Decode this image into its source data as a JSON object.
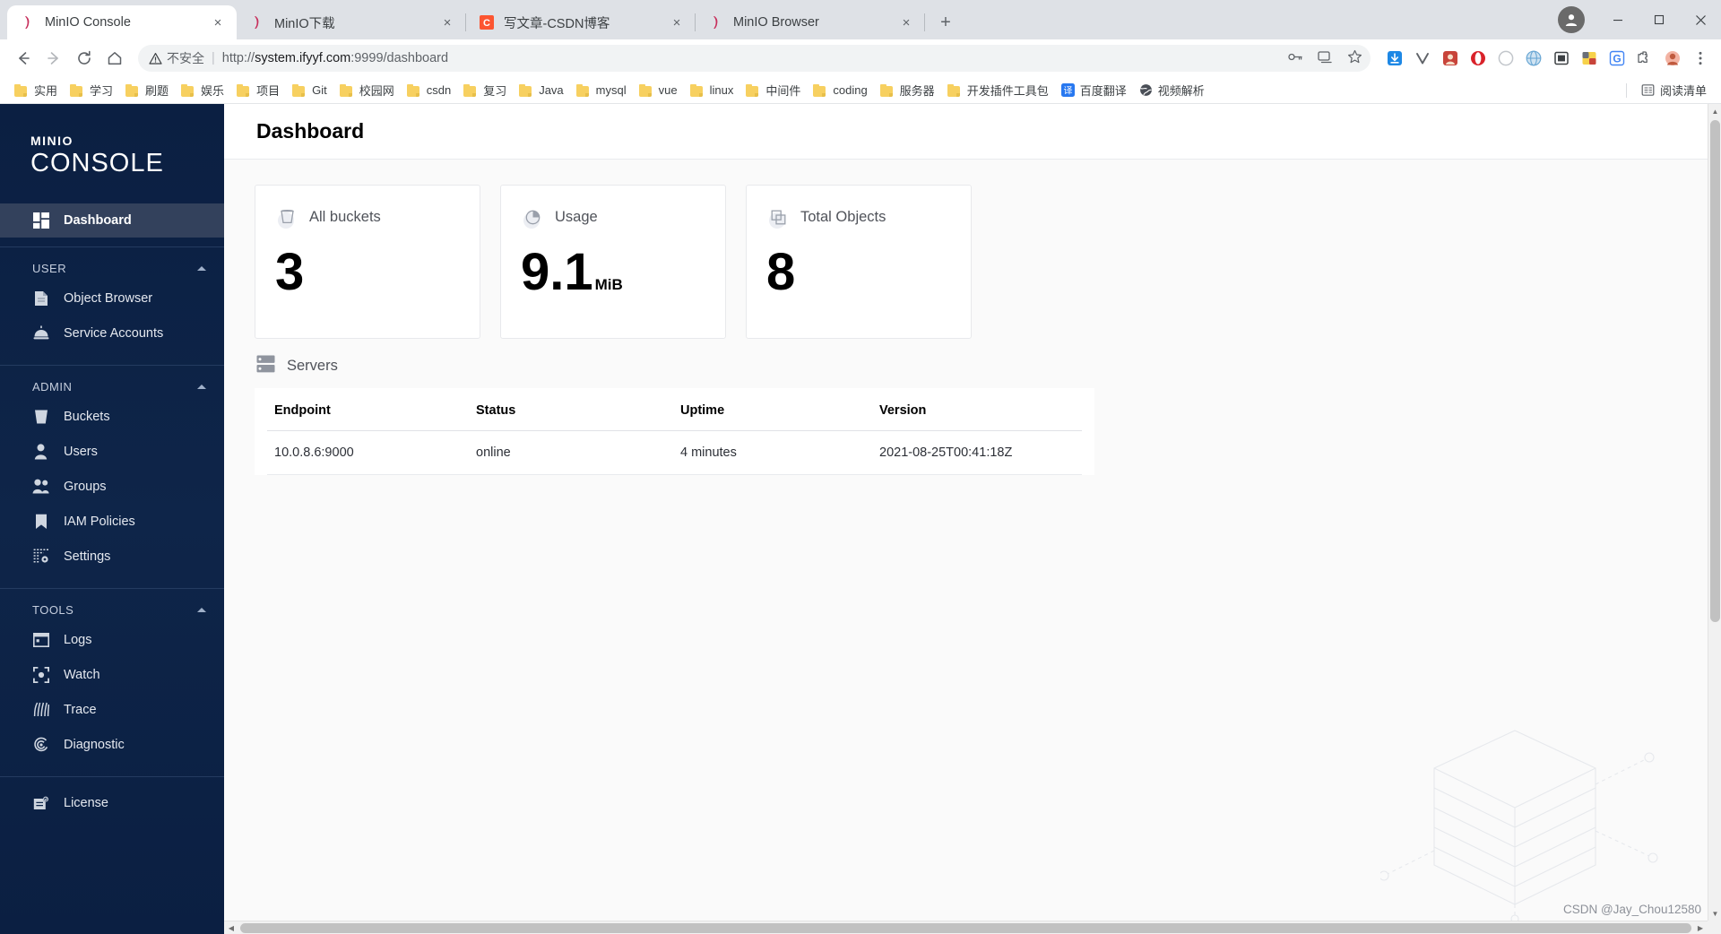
{
  "browser": {
    "tabs": [
      {
        "title": "MinIO Console",
        "favicon": "minio-icon",
        "active": true,
        "close_label": "×"
      },
      {
        "title": "MinIO下载",
        "favicon": "minio-icon",
        "active": false,
        "close_label": "×"
      },
      {
        "title": "写文章-CSDN博客",
        "favicon": "csdn-icon",
        "active": false,
        "close_label": "×"
      },
      {
        "title": "MinIO Browser",
        "favicon": "minio-icon",
        "active": false,
        "close_label": "×"
      }
    ],
    "new_tab_label": "+",
    "window_controls": {
      "minimize": "—",
      "maximize": "❐",
      "close": "✕"
    },
    "nav": {
      "back": "←",
      "forward": "→",
      "reload": "⟳",
      "home": "⌂"
    },
    "omnibox": {
      "security_label": "不安全",
      "separator": "|",
      "url_scheme": "http://",
      "url_host": "system.ifyyf.com",
      "url_rest": ":9999/dashboard",
      "full_url": "http://system.ifyyf.com:9999/dashboard"
    },
    "bookmarks": [
      {
        "label": "实用",
        "icon": "folder-icon"
      },
      {
        "label": "学习",
        "icon": "folder-icon"
      },
      {
        "label": "刷题",
        "icon": "folder-icon"
      },
      {
        "label": "娱乐",
        "icon": "folder-icon"
      },
      {
        "label": "项目",
        "icon": "folder-icon"
      },
      {
        "label": "Git",
        "icon": "folder-icon"
      },
      {
        "label": "校园网",
        "icon": "folder-icon"
      },
      {
        "label": "csdn",
        "icon": "folder-icon"
      },
      {
        "label": "复习",
        "icon": "folder-icon"
      },
      {
        "label": "Java",
        "icon": "folder-icon"
      },
      {
        "label": "mysql",
        "icon": "folder-icon"
      },
      {
        "label": "vue",
        "icon": "folder-icon"
      },
      {
        "label": "linux",
        "icon": "folder-icon"
      },
      {
        "label": "中间件",
        "icon": "folder-icon"
      },
      {
        "label": "coding",
        "icon": "folder-icon"
      },
      {
        "label": "服务器",
        "icon": "folder-icon"
      },
      {
        "label": "开发插件工具包",
        "icon": "folder-icon"
      },
      {
        "label": "百度翻译",
        "icon": "translate-icon"
      },
      {
        "label": "视频解析",
        "icon": "globe-icon"
      }
    ],
    "reading_list": {
      "label": "阅读清单",
      "icon": "reading-list-icon"
    }
  },
  "sidebar": {
    "logo_top": "MINIO",
    "logo_bottom": "CONSOLE",
    "top_item": {
      "label": "Dashboard",
      "icon": "dashboard-icon",
      "active": true
    },
    "groups": [
      {
        "title": "USER",
        "items": [
          {
            "label": "Object Browser",
            "icon": "document-icon"
          },
          {
            "label": "Service Accounts",
            "icon": "bell-service-icon"
          }
        ]
      },
      {
        "title": "ADMIN",
        "items": [
          {
            "label": "Buckets",
            "icon": "bucket-icon"
          },
          {
            "label": "Users",
            "icon": "user-icon"
          },
          {
            "label": "Groups",
            "icon": "groups-icon"
          },
          {
            "label": "IAM Policies",
            "icon": "bookmark-icon"
          },
          {
            "label": "Settings",
            "icon": "settings-icon"
          }
        ]
      },
      {
        "title": "TOOLS",
        "items": [
          {
            "label": "Logs",
            "icon": "logs-icon"
          },
          {
            "label": "Watch",
            "icon": "watch-icon"
          },
          {
            "label": "Trace",
            "icon": "trace-icon"
          },
          {
            "label": "Diagnostic",
            "icon": "diagnostic-icon"
          }
        ]
      }
    ],
    "footer_items": [
      {
        "label": "License",
        "icon": "license-icon"
      }
    ]
  },
  "page": {
    "title": "Dashboard",
    "cards": [
      {
        "label": "All buckets",
        "value": "3",
        "unit": "",
        "icon": "bucket-outline-icon"
      },
      {
        "label": "Usage",
        "value": "9.1",
        "unit": "MiB",
        "icon": "pie-chart-icon"
      },
      {
        "label": "Total Objects",
        "value": "8",
        "unit": "",
        "icon": "objects-icon"
      }
    ],
    "servers_section": {
      "label": "Servers",
      "icon": "server-rack-icon"
    },
    "table": {
      "columns": [
        "Endpoint",
        "Status",
        "Uptime",
        "Version"
      ],
      "rows": [
        {
          "endpoint": "10.0.8.6:9000",
          "status": "online",
          "uptime": "4 minutes",
          "version": "2021-08-25T00:41:18Z"
        }
      ]
    }
  },
  "watermark": "CSDN @Jay_Chou12580",
  "colors": {
    "sidebar_bg": "#0b1f42",
    "sidebar_active": "#33415c",
    "browser_tabstrip": "#dee1e6",
    "accent_folder": "#f7d060",
    "text_dark": "#000000"
  }
}
